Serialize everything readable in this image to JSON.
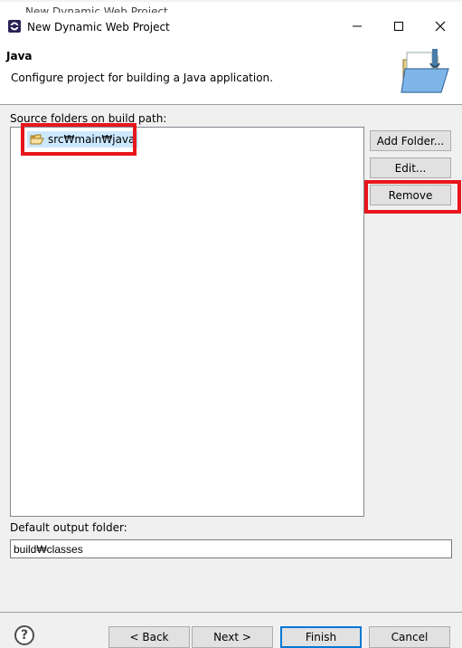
{
  "background_window": {
    "title": "New Dynamic Web Project"
  },
  "window": {
    "title": "New Dynamic Web Project",
    "controls": {
      "minimize": "minimize-icon",
      "maximize": "maximize-icon",
      "close": "close-icon"
    }
  },
  "banner": {
    "title": "Java",
    "description": "Configure project for building a Java application.",
    "image": "java-folder-wizard-icon"
  },
  "source_folders": {
    "label": "Source folders on build path:",
    "items": [
      {
        "label": "src₩main₩java",
        "icon": "source-folder-icon",
        "selected": true
      }
    ],
    "buttons": {
      "add_folder": "Add Folder...",
      "edit": "Edit...",
      "remove": "Remove"
    }
  },
  "output_folder": {
    "label": "Default output folder:",
    "value": "build₩classes"
  },
  "footer": {
    "help_icon": "help-icon",
    "back": "< Back",
    "next": "Next >",
    "finish": "Finish",
    "cancel": "Cancel"
  },
  "colors": {
    "highlight_red": "#e8161c",
    "selection": "#cce8ff",
    "default_button_border": "#0078d7"
  }
}
